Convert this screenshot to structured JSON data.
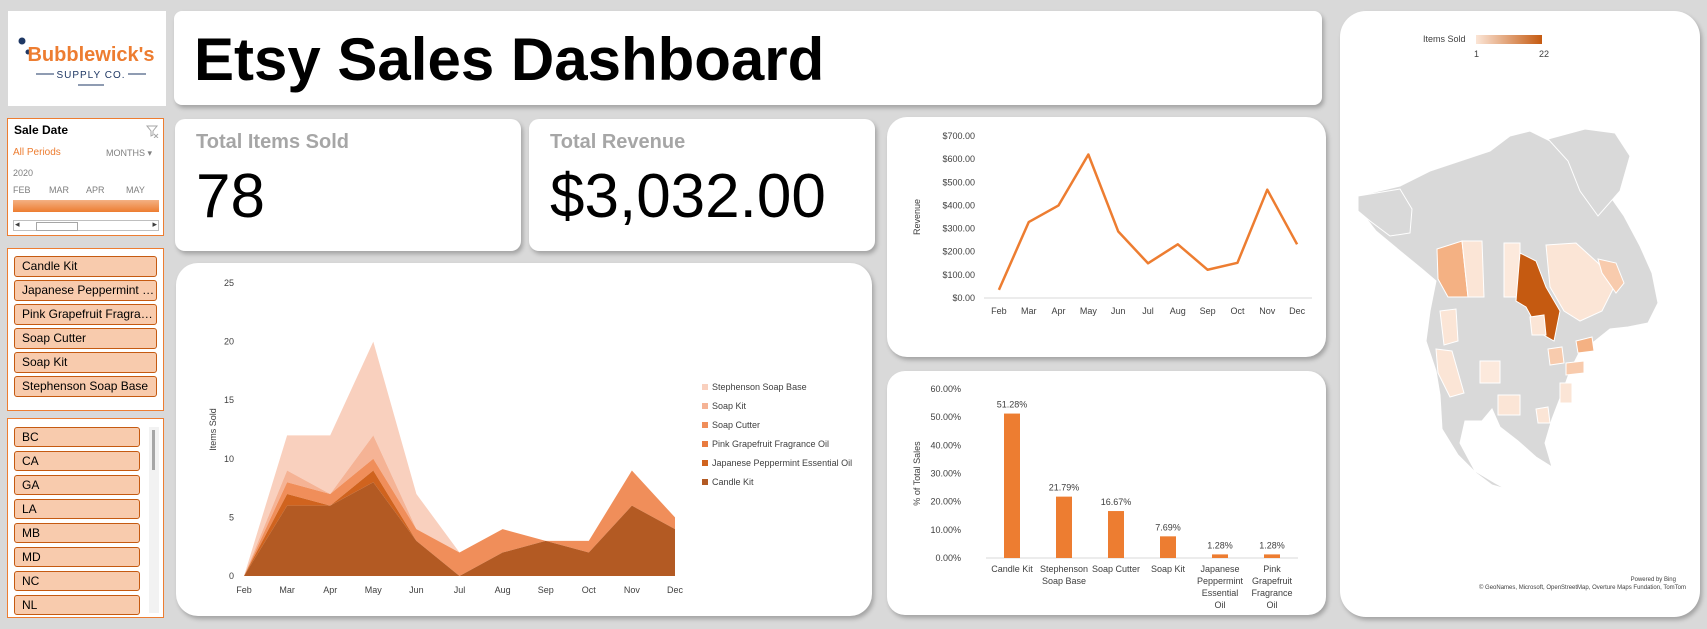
{
  "logo": {
    "brand": "Bubblewick's",
    "tagline": "SUPPLY CO."
  },
  "header": {
    "title": "Etsy Sales Dashboard"
  },
  "date_slicer": {
    "title": "Sale Date",
    "period": "All Periods",
    "level": "MONTHS",
    "year": "2020",
    "months": [
      "FEB",
      "MAR",
      "APR",
      "MAY"
    ]
  },
  "product_slicer": {
    "items": [
      "Candle Kit",
      "Japanese Peppermint Essential Oil",
      "Pink Grapefruit Fragrance Oil",
      "Soap Cutter",
      "Soap Kit",
      "Stephenson Soap Base"
    ]
  },
  "state_slicer": {
    "items": [
      "BC",
      "CA",
      "GA",
      "LA",
      "MB",
      "MD",
      "NC",
      "NL"
    ]
  },
  "kpis": {
    "items_label": "Total Items Sold",
    "items_value": "78",
    "revenue_label": "Total Revenue",
    "revenue_value": "$3,032.00"
  },
  "map": {
    "legend_title": "Items Sold",
    "legend_min": "1",
    "legend_max": "22",
    "powered": "Powered by Bing",
    "credit": "© GeoNames, Microsoft, OpenStreetMap, Overture Maps Fundation, TomTom"
  },
  "colors": {
    "accent": "#ed7d31",
    "dark": "#c55a11",
    "chip": "#f8cbad"
  },
  "chart_data": [
    {
      "type": "line",
      "ylabel": "Revenue",
      "categories": [
        "Feb",
        "Mar",
        "Apr",
        "May",
        "Jun",
        "Jul",
        "Aug",
        "Sep",
        "Oct",
        "Nov",
        "Dec"
      ],
      "values": [
        35,
        328,
        400,
        620,
        288,
        150,
        232,
        122,
        152,
        468,
        232
      ],
      "ylim": [
        0,
        700
      ],
      "yticks": [
        "$0.00",
        "$100.00",
        "$200.00",
        "$300.00",
        "$400.00",
        "$500.00",
        "$600.00",
        "$700.00"
      ],
      "color": "#ed7d31"
    },
    {
      "type": "area",
      "stacked": true,
      "ylabel": "Items Sold",
      "categories": [
        "Feb",
        "Mar",
        "Apr",
        "May",
        "Jun",
        "Jul",
        "Aug",
        "Sep",
        "Oct",
        "Nov",
        "Dec"
      ],
      "ylim": [
        0,
        25
      ],
      "yticks": [
        "0",
        "5",
        "10",
        "15",
        "20",
        "25"
      ],
      "legend_position": "right",
      "series": [
        {
          "name": "Candle Kit",
          "color": "#b35a23",
          "values": [
            0,
            6,
            6,
            8,
            3,
            0,
            2,
            3,
            2,
            6,
            4
          ]
        },
        {
          "name": "Japanese Peppermint Essential Oil",
          "color": "#d0631e",
          "values": [
            0,
            1,
            0,
            1,
            0,
            0,
            0,
            0,
            0,
            0,
            0
          ]
        },
        {
          "name": "Pink Grapefruit Fragrance Oil",
          "color": "#e97b3f",
          "values": [
            0,
            0,
            0,
            0,
            0,
            0,
            0,
            0,
            0,
            0,
            0
          ]
        },
        {
          "name": "Soap Cutter",
          "color": "#f08e5a",
          "values": [
            0,
            1,
            1,
            1,
            1,
            2,
            2,
            0,
            1,
            3,
            1
          ]
        },
        {
          "name": "Soap Kit",
          "color": "#f5b395",
          "values": [
            0,
            1,
            0,
            2,
            0,
            0,
            0,
            0,
            0,
            0,
            0
          ]
        },
        {
          "name": "Stephenson Soap Base",
          "color": "#f9d0be",
          "values": [
            0,
            3,
            5,
            8,
            3,
            0,
            0,
            0,
            0,
            0,
            0
          ]
        }
      ]
    },
    {
      "type": "bar",
      "ylabel": "% of Total Sales",
      "categories": [
        "Candle Kit",
        "Stephenson Soap Base",
        "Soap Cutter",
        "Soap Kit",
        "Japanese Peppermint Essential Oil",
        "Pink Grapefruit Fragrance Oil"
      ],
      "values": [
        51.28,
        21.79,
        16.67,
        7.69,
        1.28,
        1.28
      ],
      "labels": [
        "51.28%",
        "21.79%",
        "16.67%",
        "7.69%",
        "1.28%",
        "1.28%"
      ],
      "ylim": [
        0,
        60
      ],
      "yticks": [
        "0.00%",
        "10.00%",
        "20.00%",
        "30.00%",
        "40.00%",
        "50.00%",
        "60.00%"
      ],
      "color": "#ed7d31"
    }
  ]
}
